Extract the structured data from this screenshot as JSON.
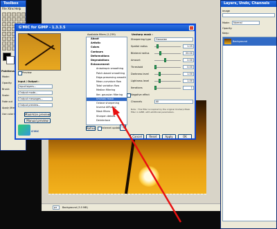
{
  "toolbox": {
    "title": "Toolbox",
    "menu": "File  Xtns  Help",
    "tool_options": "Paintbrush",
    "options": [
      "Mode:",
      "Opacity:",
      "Brush:",
      "Scale:",
      "Fade out",
      "Apply Jitter",
      "Use color from gradient"
    ]
  },
  "layers_dialog": {
    "title": "Layers, Undo, Channels",
    "image": "Image",
    "mode_label": "Mode:",
    "mode_value": "Normal",
    "opacity_label": "Opacity:",
    "keep_label": "Keep:",
    "layer_name": "Background"
  },
  "gmic": {
    "title": "G'MIC for GIMP - 1.3.3.5",
    "preview_label": "Preview",
    "input_output_label": "Input / Output :",
    "io_fields": [
      "Input layers...",
      "Output mode...",
      "Output messages...",
      "Output preview..."
    ],
    "maximize_button": "Maximize preview",
    "manual_button": "Manual preview",
    "logo_text": "G'MIC",
    "available_filters": "Available filters (2,239)",
    "tree": [
      {
        "label": "About",
        "cat": true
      },
      {
        "label": "Artistic",
        "cat": true
      },
      {
        "label": "Colors",
        "cat": true
      },
      {
        "label": "Contours",
        "cat": true
      },
      {
        "label": "Deformations",
        "cat": true
      },
      {
        "label": "Degradations",
        "cat": true
      },
      {
        "label": "Enhancement",
        "cat": true
      },
      {
        "label": "Anisotropic smoothing"
      },
      {
        "label": "Patch-based smoothing"
      },
      {
        "label": "Edge-preserving smooth"
      },
      {
        "label": "Mean-curvature flow"
      },
      {
        "label": "Total variation flow"
      },
      {
        "label": "Median filtering"
      },
      {
        "label": "Iter. gaussian filtering"
      },
      {
        "label": "Unsharp mask",
        "selected": true
      },
      {
        "label": "Octave sharpening"
      },
      {
        "label": "Inverse diffusion"
      },
      {
        "label": "Mask filters"
      },
      {
        "label": "Sharpen details"
      },
      {
        "label": "Deinterlace"
      }
    ],
    "refresh_button": "Refresh",
    "internet_updates": "Internet updates",
    "params_title": "Unsharp mask :",
    "params": [
      {
        "label": "Sharpening type",
        "value": "Gaussian",
        "kind": "select"
      },
      {
        "label": "Spatial radius",
        "value": "1.25",
        "frac": 0.08
      },
      {
        "label": "Bilateral radius",
        "value": "20.00",
        "frac": 0.2
      },
      {
        "label": "Amount",
        "value": "2.00",
        "frac": 0.4
      },
      {
        "label": "Threshold",
        "value": "0.00",
        "frac": 0.0
      },
      {
        "label": "Darkness level",
        "value": "1.00",
        "frac": 0.18
      },
      {
        "label": "Lightness level",
        "value": "1.00",
        "frac": 0.18
      },
      {
        "label": "Iterations",
        "value": "1",
        "frac": 0.0
      },
      {
        "label": "Negative effect",
        "kind": "check"
      },
      {
        "label": "Channels",
        "value": "All",
        "kind": "select"
      }
    ],
    "note": "Note : This filter is inspired by the original Unsharp Mask filter in GIMP, with additional parameters.",
    "cancel": "Cancel",
    "reset": "Reset",
    "apply": "Apply",
    "ok": "OK"
  },
  "statusbar": {
    "zoom": "px",
    "status": "Background (3.5 MB)"
  },
  "colors": {
    "sky_top": "#3a1f02",
    "sky_mid": "#c47a0a",
    "sky_bottom": "#f0b01a",
    "sun": "#fff6c8"
  }
}
